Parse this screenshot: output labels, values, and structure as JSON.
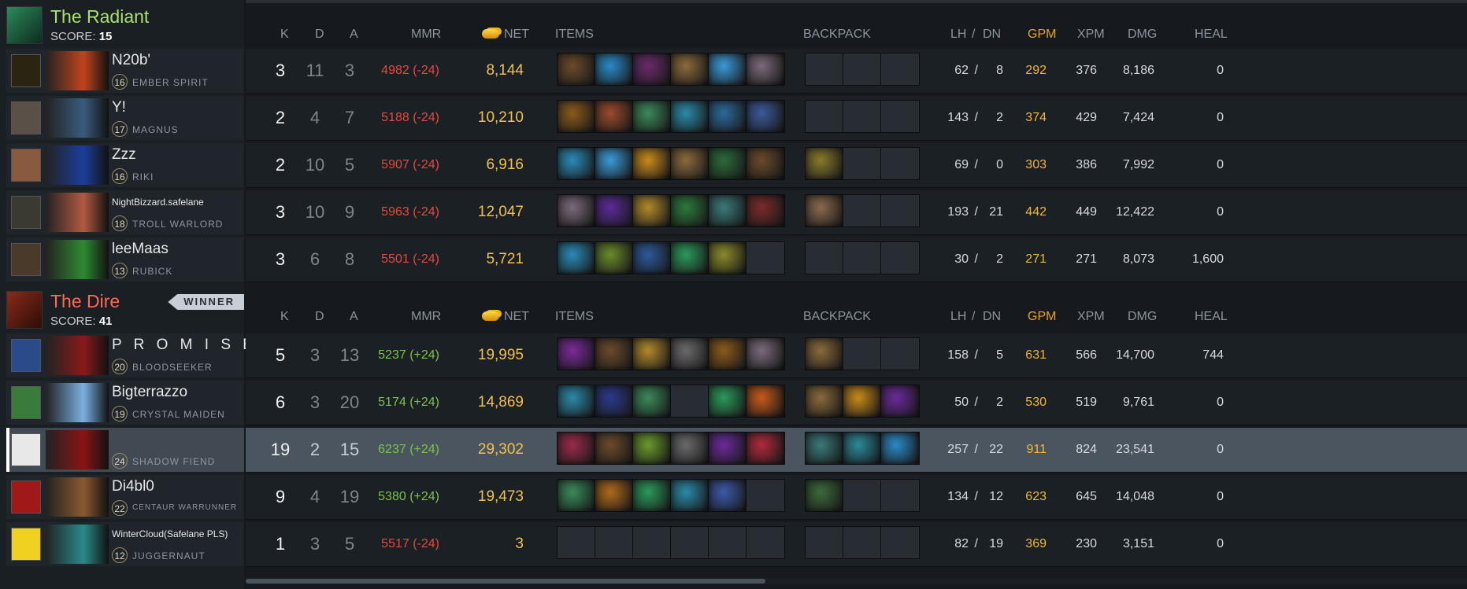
{
  "radiant": {
    "name": "The Radiant",
    "score_label": "SCORE:",
    "score": "15",
    "colors": {
      "name": "#a8e06a",
      "crest": "#2c8a5a"
    },
    "players": [
      {
        "name": "N20b'",
        "level": "16",
        "hero": "EMBER SPIRIT",
        "avatar": "#2a2410",
        "hero_color": "#c0441c"
      },
      {
        "name": "Y!",
        "level": "17",
        "hero": "MAGNUS",
        "avatar": "#5a5048",
        "hero_color": "#3a5c7c"
      },
      {
        "name": "Zzz",
        "level": "16",
        "hero": "RIKI",
        "avatar": "#8a5a40",
        "hero_color": "#1c3e9c"
      },
      {
        "name": "NightBizzard.safelane",
        "level": "18",
        "hero": "TROLL WARLORD",
        "avatar": "#3a3a30",
        "hero_color": "#b05a40"
      },
      {
        "name": "leeMaas",
        "level": "13",
        "hero": "RUBICK",
        "avatar": "#4a3a2a",
        "hero_color": "#2e8a30"
      }
    ]
  },
  "dire": {
    "name": "The Dire",
    "score_label": "SCORE:",
    "score": "41",
    "winner_label": "WINNER",
    "colors": {
      "name": "#ff6a55",
      "crest": "#8a2a1a"
    },
    "players": [
      {
        "name": "P R O M I S E",
        "level": "20",
        "hero": "BLOODSEEKER",
        "avatar": "#2a4a8a",
        "hero_color": "#8a1a1a"
      },
      {
        "name": "Bigterrazzo",
        "level": "19",
        "hero": "CRYSTAL MAIDEN",
        "avatar": "#3a7a3a",
        "hero_color": "#7ab0e0"
      },
      {
        "name": "",
        "level": "24",
        "hero": "SHADOW FIEND",
        "avatar": "#e8e8e8",
        "hero_color": "#8a1414"
      },
      {
        "name": "Di4bl0",
        "level": "22",
        "hero": "CENTAUR WARRUNNER",
        "avatar": "#a01818",
        "hero_color": "#8a5a30"
      },
      {
        "name": "WinterCloud(Safelane PLS)",
        "level": "12",
        "hero": "JUGGERNAUT",
        "avatar": "#f0d020",
        "hero_color": "#2a8a8a"
      }
    ]
  },
  "columns": {
    "k": "K",
    "d": "D",
    "a": "A",
    "mmr": "MMR",
    "net": "NET",
    "items": "ITEMS",
    "backpack": "BACKPACK",
    "lh": "LH",
    "sep": "/",
    "dn": "DN",
    "gpm": "GPM",
    "xpm": "XPM",
    "dmg": "DMG",
    "heal": "HEAL"
  },
  "radiant_rows": [
    {
      "k": "3",
      "d": "11",
      "a": "3",
      "mmr": "4982 (-24)",
      "mmr_sign": "neg",
      "net": "8,144",
      "lh": "62",
      "dn": "8",
      "gpm": "292",
      "xpm": "376",
      "dmg": "8,186",
      "heal": "0",
      "items": [
        {
          "name": "boots",
          "color": "#6a4a2a"
        },
        {
          "name": "magic-wand",
          "color": "#2a8ac8"
        },
        {
          "name": "dagon",
          "color": "#6a2a6a"
        },
        {
          "name": "tp-scroll",
          "color": "#8a6a3a"
        },
        {
          "name": "refresher",
          "color": "#3a9ad8"
        },
        {
          "name": "orb",
          "color": "#7a6a7a"
        }
      ],
      "backpack": [
        null,
        null,
        null
      ]
    },
    {
      "k": "2",
      "d": "4",
      "a": "7",
      "mmr": "5188 (-24)",
      "mmr_sign": "neg",
      "net": "10,210",
      "lh": "143",
      "dn": "2",
      "gpm": "374",
      "xpm": "429",
      "dmg": "7,424",
      "heal": "0",
      "items": [
        {
          "name": "claws",
          "color": "#8a5a1a"
        },
        {
          "name": "stout-shield",
          "color": "#9a4a2a"
        },
        {
          "name": "staff",
          "color": "#3a8a5a"
        },
        {
          "name": "blade",
          "color": "#2a8aa8"
        },
        {
          "name": "ring",
          "color": "#2a6a9a"
        },
        {
          "name": "wand",
          "color": "#3a5a9a"
        }
      ],
      "backpack": [
        null,
        null,
        null
      ]
    },
    {
      "k": "2",
      "d": "10",
      "a": "5",
      "mmr": "5907 (-24)",
      "mmr_sign": "neg",
      "net": "6,916",
      "lh": "69",
      "dn": "0",
      "gpm": "303",
      "xpm": "386",
      "dmg": "7,992",
      "heal": "0",
      "items": [
        {
          "name": "wind-lace",
          "color": "#2a8ab8"
        },
        {
          "name": "refresher",
          "color": "#3a9ad8"
        },
        {
          "name": "bottle",
          "color": "#c88a1a"
        },
        {
          "name": "tp-scroll",
          "color": "#8a6a3a"
        },
        {
          "name": "dagger",
          "color": "#2a6a3a"
        },
        {
          "name": "boots",
          "color": "#6a4a2a"
        }
      ],
      "backpack": [
        {
          "name": "branches",
          "color": "#8a7a2a"
        },
        null,
        null
      ]
    },
    {
      "k": "3",
      "d": "10",
      "a": "9",
      "mmr": "5963 (-24)",
      "mmr_sign": "neg",
      "net": "12,047",
      "lh": "193",
      "dn": "21",
      "gpm": "442",
      "xpm": "449",
      "dmg": "12,422",
      "heal": "0",
      "items": [
        {
          "name": "orb",
          "color": "#7a6a7a"
        },
        {
          "name": "cloak",
          "color": "#5a2a9a"
        },
        {
          "name": "mask",
          "color": "#b08a2a"
        },
        {
          "name": "sword",
          "color": "#2a7a3a"
        },
        {
          "name": "ring",
          "color": "#3a7a7a"
        },
        {
          "name": "helm",
          "color": "#7a2a2a"
        }
      ],
      "backpack": [
        {
          "name": "axe",
          "color": "#8a6a4a"
        },
        null,
        null
      ]
    },
    {
      "k": "3",
      "d": "6",
      "a": "8",
      "mmr": "5501 (-24)",
      "mmr_sign": "neg",
      "net": "5,721",
      "lh": "30",
      "dn": "2",
      "gpm": "271",
      "xpm": "271",
      "dmg": "8,073",
      "heal": "1,600",
      "items": [
        {
          "name": "wind-lace",
          "color": "#2a8ab8"
        },
        {
          "name": "potion",
          "color": "#6a8a2a"
        },
        {
          "name": "aether-orb",
          "color": "#2a5a9a"
        },
        {
          "name": "tranquil-boots",
          "color": "#2a9a5a"
        },
        {
          "name": "bracer",
          "color": "#8a8a2a"
        },
        null
      ],
      "backpack": [
        null,
        null,
        null
      ]
    }
  ],
  "dire_rows": [
    {
      "k": "5",
      "d": "3",
      "a": "13",
      "mmr": "5237 (+24)",
      "mmr_sign": "pos",
      "net": "19,995",
      "lh": "158",
      "dn": "5",
      "gpm": "631",
      "xpm": "566",
      "dmg": "14,700",
      "heal": "744",
      "items": [
        {
          "name": "battlefury",
          "color": "#7a2a9a"
        },
        {
          "name": "boots",
          "color": "#6a4a2a"
        },
        {
          "name": "mask",
          "color": "#b08a2a"
        },
        {
          "name": "desolator",
          "color": "#6a6a6a"
        },
        {
          "name": "claws",
          "color": "#8a5a1a"
        },
        {
          "name": "orb",
          "color": "#7a6a7a"
        }
      ],
      "backpack": [
        {
          "name": "tp-scroll",
          "color": "#8a6a3a"
        },
        null,
        null
      ]
    },
    {
      "k": "6",
      "d": "3",
      "a": "20",
      "mmr": "5174 (+24)",
      "mmr_sign": "pos",
      "net": "14,869",
      "lh": "50",
      "dn": "2",
      "gpm": "530",
      "xpm": "519",
      "dmg": "9,761",
      "heal": "0",
      "items": [
        {
          "name": "blade",
          "color": "#2a8aa8"
        },
        {
          "name": "robe",
          "color": "#2a3a8a"
        },
        {
          "name": "staff",
          "color": "#3a8a5a"
        },
        null,
        {
          "name": "tranquil-boots",
          "color": "#2a9a5a"
        },
        {
          "name": "fire-orb",
          "color": "#c85a1a"
        }
      ],
      "backpack": [
        {
          "name": "tp-scroll",
          "color": "#8a6a3a"
        },
        {
          "name": "bottle",
          "color": "#c88a1a"
        },
        {
          "name": "mana-orb",
          "color": "#6a2a9a"
        }
      ]
    },
    {
      "k": "19",
      "d": "2",
      "a": "15",
      "mmr": "6237 (+24)",
      "mmr_sign": "pos",
      "net": "29,302",
      "lh": "257",
      "dn": "22",
      "gpm": "911",
      "xpm": "824",
      "dmg": "23,541",
      "heal": "0",
      "items": [
        {
          "name": "crystalys",
          "color": "#9a2a4a"
        },
        {
          "name": "boots",
          "color": "#6a4a2a"
        },
        {
          "name": "eul",
          "color": "#6a9a2a"
        },
        {
          "name": "desolator",
          "color": "#6a6a6a"
        },
        {
          "name": "daedalus",
          "color": "#6a2a9a"
        },
        {
          "name": "blood-blade",
          "color": "#b02a3a"
        }
      ],
      "backpack": [
        {
          "name": "ring",
          "color": "#3a7a7a"
        },
        {
          "name": "flask",
          "color": "#2a8a9a"
        },
        {
          "name": "magic-wand",
          "color": "#2a8ac8"
        }
      ]
    },
    {
      "k": "9",
      "d": "4",
      "a": "19",
      "mmr": "5380 (+24)",
      "mmr_sign": "pos",
      "net": "19,473",
      "lh": "134",
      "dn": "12",
      "gpm": "623",
      "xpm": "645",
      "dmg": "14,048",
      "heal": "0",
      "items": [
        {
          "name": "staff",
          "color": "#3a8a5a"
        },
        {
          "name": "bracer",
          "color": "#b06a1a"
        },
        {
          "name": "tranquil-boots",
          "color": "#2a9a5a"
        },
        {
          "name": "blade",
          "color": "#2a8aa8"
        },
        {
          "name": "axe",
          "color": "#3a5aa8"
        },
        null
      ],
      "backpack": [
        {
          "name": "spear",
          "color": "#3a6a3a"
        },
        null,
        null
      ]
    },
    {
      "k": "1",
      "d": "3",
      "a": "5",
      "mmr": "5517 (-24)",
      "mmr_sign": "neg",
      "net": "3",
      "lh": "82",
      "dn": "19",
      "gpm": "369",
      "xpm": "230",
      "dmg": "3,151",
      "heal": "0",
      "items": [
        null,
        null,
        null,
        null,
        null,
        null
      ],
      "backpack": [
        null,
        null,
        null
      ]
    }
  ]
}
